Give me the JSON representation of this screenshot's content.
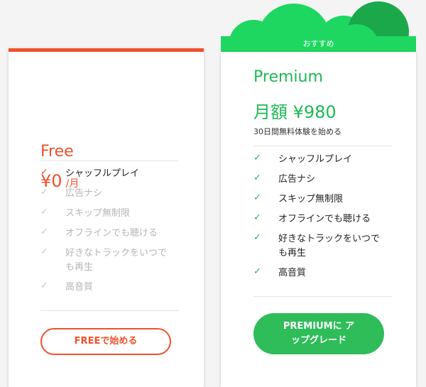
{
  "free": {
    "name": "Free",
    "price_amount": "¥0",
    "price_unit": "/月",
    "features": [
      {
        "check": "✓",
        "label": "シャッフルプレイ",
        "active": true
      },
      {
        "check": "✓",
        "label": "広告ナシ",
        "active": false
      },
      {
        "check": "✓",
        "label": "スキップ無制限",
        "active": false
      },
      {
        "check": "✓",
        "label": "オフラインでも聴ける",
        "active": false
      },
      {
        "check": "✓",
        "label_line1": "好きなトラックをいつで",
        "label_line2": "も再生",
        "active": false
      },
      {
        "check": "✓",
        "label": "高音質",
        "active": false
      }
    ],
    "button_label": "FREEで始める",
    "accent_color": "#f0512d"
  },
  "premium": {
    "ribbon": "おすすめ",
    "name": "Premium",
    "price": "月額 ¥980",
    "trial": "30日間無料体験を始める",
    "features": [
      {
        "check": "✓",
        "label": "シャッフルプレイ"
      },
      {
        "check": "✓",
        "label": "広告ナシ"
      },
      {
        "check": "✓",
        "label": "スキップ無制限"
      },
      {
        "check": "✓",
        "label": "オフラインでも聴ける"
      },
      {
        "check": "✓",
        "label_line1": "好きなトラックをいつで",
        "label_line2": "も再生"
      },
      {
        "check": "✓",
        "label": "高音質"
      }
    ],
    "button_line1": "PREMIUMに ア",
    "button_line2": "ップグレード",
    "accent_color": "#1ed760"
  }
}
